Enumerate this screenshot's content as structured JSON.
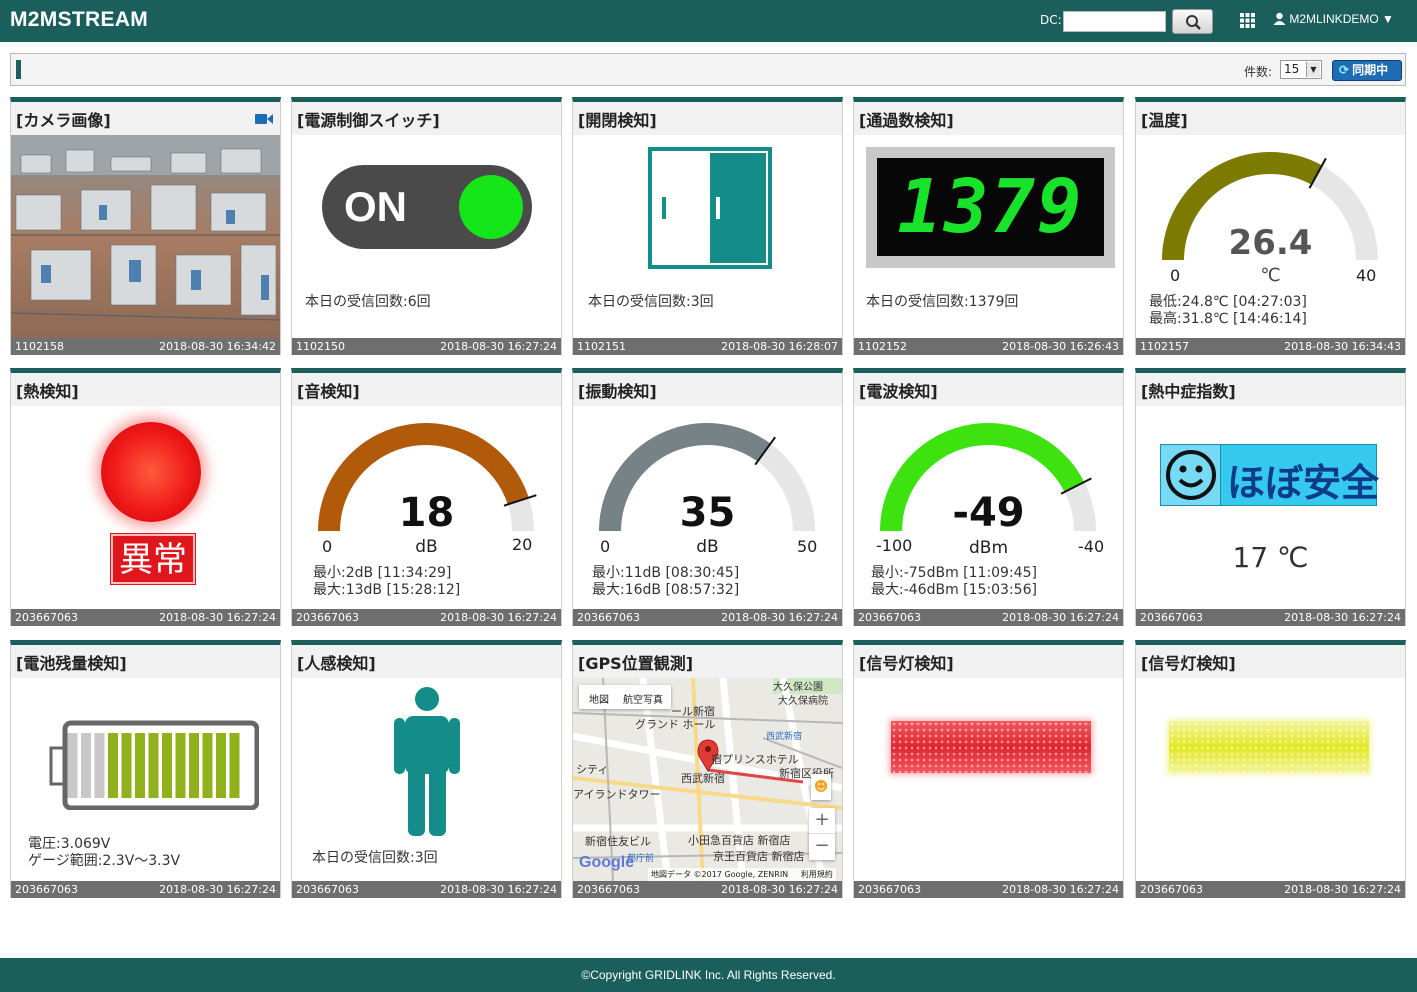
{
  "header": {
    "brand": "M2MSTREAM",
    "dc_label": "DC:",
    "dc_value": "",
    "user": "M2MLINKDEMO ▼"
  },
  "toolbar": {
    "count_label": "件数:",
    "count_value": "15",
    "sync_label": "同期中"
  },
  "colors": {
    "brand": "#1a5f5c",
    "footer": "#1a5f5c",
    "sync_button": "#1e6db4"
  },
  "cards": [
    {
      "title": "[カメラ画像]",
      "id": "1102158",
      "time": "2018-08-30 16:34:42"
    },
    {
      "title": "[電源制御スイッチ]",
      "switch_label": "ON",
      "info": "本日の受信回数:6回",
      "id": "1102150",
      "time": "2018-08-30 16:27:24"
    },
    {
      "title": "[開閉検知]",
      "info": "本日の受信回数:3回",
      "id": "1102151",
      "time": "2018-08-30 16:28:07"
    },
    {
      "title": "[通過数検知]",
      "counter": "1379",
      "info": "本日の受信回数:1379回",
      "id": "1102152",
      "time": "2018-08-30 16:26:43"
    },
    {
      "title": "[温度]",
      "value": "26.4",
      "value_num": 26.4,
      "unit": "℃",
      "min": "0",
      "max": "40",
      "min_num": 0,
      "max_num": 40,
      "info1": "最低:24.8℃ [04:27:03]",
      "info2": "最高:31.8℃ [14:46:14]",
      "id": "1102157",
      "time": "2018-08-30 16:34:43"
    },
    {
      "title": "[熱検知]",
      "status": "異常",
      "id": "203667063",
      "time": "2018-08-30 16:27:24"
    },
    {
      "title": "[音検知]",
      "value": "18",
      "value_num": 18,
      "unit": "dB",
      "min": "0",
      "max": "20",
      "min_num": 0,
      "max_num": 20,
      "info1": "最小:2dB [11:34:29]",
      "info2": "最大:13dB [15:28:12]",
      "id": "203667063",
      "time": "2018-08-30 16:27:24"
    },
    {
      "title": "[振動検知]",
      "value": "35",
      "value_num": 35,
      "unit": "dB",
      "min": "0",
      "max": "50",
      "min_num": 0,
      "max_num": 50,
      "info1": "最小:11dB [08:30:45]",
      "info2": "最大:16dB [08:57:32]",
      "id": "203667063",
      "time": "2018-08-30 16:27:24"
    },
    {
      "title": "[電波検知]",
      "value": "-49",
      "value_num": -49,
      "unit": "dBm",
      "min": "-100",
      "max": "-40",
      "min_num": -100,
      "max_num": -40,
      "info1": "最小:-75dBm [11:09:45]",
      "info2": "最大:-46dBm [15:03:56]",
      "id": "203667063",
      "time": "2018-08-30 16:27:24"
    },
    {
      "title": "[熱中症指数]",
      "status": "ほぼ安全",
      "temp": "17 ℃",
      "id": "203667063",
      "time": "2018-08-30 16:27:24"
    },
    {
      "title": "[電池残量検知]",
      "info1": "電圧:3.069V",
      "info2": "ゲージ範囲:2.3V～3.3V",
      "charge_fraction": 0.77,
      "id": "203667063",
      "time": "2018-08-30 16:27:24"
    },
    {
      "title": "[人感検知]",
      "info": "本日の受信回数:3回",
      "id": "203667063",
      "time": "2018-08-30 16:27:24"
    },
    {
      "title": "[GPS位置観測]",
      "id": "203667063",
      "time": "2018-08-30 16:27:24",
      "map_tabs": [
        "地図",
        "航空写真"
      ],
      "map_labels": [
        "大久保公園",
        "大久保病院",
        "ール新宿",
        "グランド ホール",
        "西武新宿",
        "宿プリンスホテル",
        "シティ",
        "西武新宿",
        "新宿区役所",
        "アイランドタワー",
        "新宿住友ビル",
        "小田急百貨店 新宿店",
        "京王百貨店 新宿店",
        "都庁前"
      ],
      "google": "Google",
      "map_credit": "地図データ ©2017 Google, ZENRIN",
      "map_terms": "利用規約"
    },
    {
      "title": "[信号灯検知]",
      "id": "203667063",
      "time": "2018-08-30 16:27:24"
    },
    {
      "title": "[信号灯検知]",
      "id": "203667063",
      "time": "2018-08-30 16:27:24"
    }
  ],
  "footer": {
    "copyright": "©Copyright GRIDLINK Inc. All Rights Reserved."
  }
}
